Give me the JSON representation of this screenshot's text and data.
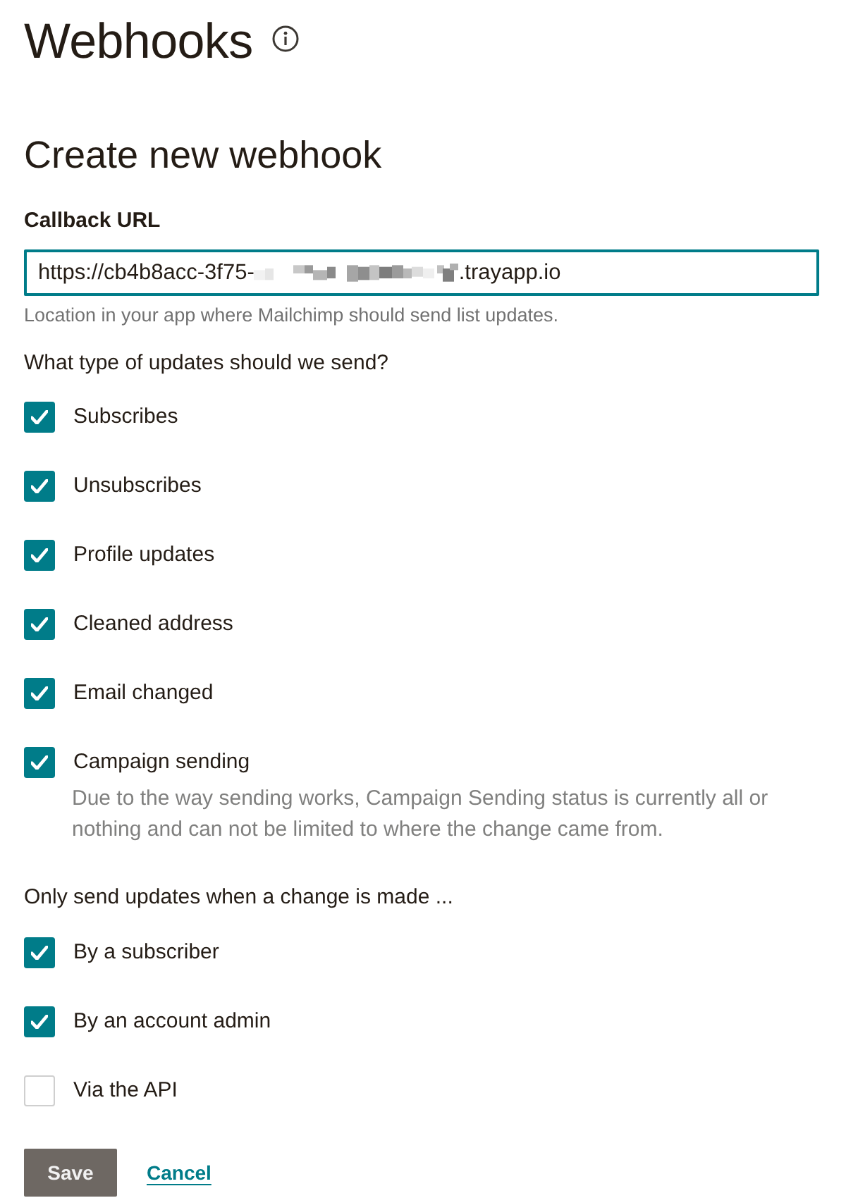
{
  "page": {
    "title": "Webhooks"
  },
  "form": {
    "heading": "Create new webhook",
    "callback_url": {
      "label": "Callback URL",
      "value_prefix": "https://cb4b8acc-3f75-",
      "redacted": true,
      "value_suffix": ".trayapp.io",
      "focused": true,
      "helper": "Location in your app where Mailchimp should send list updates."
    },
    "update_types": {
      "question": "What type of updates should we send?",
      "options": [
        {
          "label": "Subscribes",
          "checked": true
        },
        {
          "label": "Unsubscribes",
          "checked": true
        },
        {
          "label": "Profile updates",
          "checked": true
        },
        {
          "label": "Cleaned address",
          "checked": true
        },
        {
          "label": "Email changed",
          "checked": true
        },
        {
          "label": "Campaign sending",
          "checked": true,
          "description": "Due to the way sending works, Campaign Sending status is currently all or nothing and can not be limited to where the change came from."
        }
      ]
    },
    "sources": {
      "question": "Only send updates when a change is made ...",
      "options": [
        {
          "label": "By a subscriber",
          "checked": true
        },
        {
          "label": "By an account admin",
          "checked": true
        },
        {
          "label": "Via the API",
          "checked": false
        }
      ]
    },
    "actions": {
      "save": "Save",
      "cancel": "Cancel"
    }
  }
}
